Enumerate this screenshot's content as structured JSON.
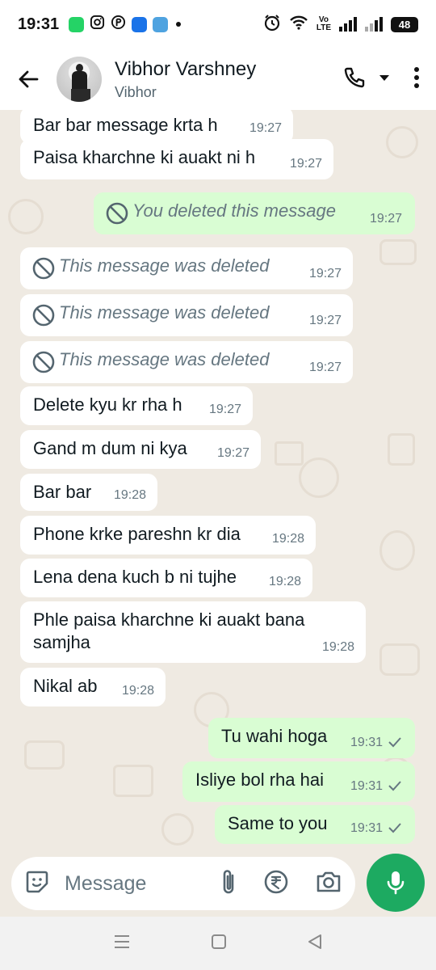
{
  "status_bar": {
    "time": "19:31",
    "volte_label_top": "Vo",
    "volte_label_bottom": "LTE",
    "battery": "48",
    "icons": [
      "whatsapp-business-icon",
      "instagram-icon",
      "phonepe-icon",
      "bluesky-icon",
      "weather-icon",
      "dot-icon",
      "alarm-icon",
      "wifi-icon",
      "volte-icon",
      "signal-icon",
      "battery-icon"
    ]
  },
  "header": {
    "contact_name": "Vibhor Varshney",
    "contact_subtitle": "Vibhor"
  },
  "messages": [
    {
      "dir": "in",
      "text": "Bar bar message krta h",
      "time": "19:27",
      "deleted": false
    },
    {
      "dir": "in",
      "text": "Paisa kharchne ki auakt ni h",
      "time": "19:27",
      "deleted": false
    },
    {
      "dir": "out",
      "text": "You deleted this message",
      "time": "19:27",
      "deleted": true
    },
    {
      "dir": "in",
      "text": "This message was deleted",
      "time": "19:27",
      "deleted": true
    },
    {
      "dir": "in",
      "text": "This message was deleted",
      "time": "19:27",
      "deleted": true
    },
    {
      "dir": "in",
      "text": "This message was deleted",
      "time": "19:27",
      "deleted": true
    },
    {
      "dir": "in",
      "text": "Delete kyu kr rha h",
      "time": "19:27",
      "deleted": false
    },
    {
      "dir": "in",
      "text": "Gand m dum ni kya",
      "time": "19:27",
      "deleted": false
    },
    {
      "dir": "in",
      "text": "Bar bar",
      "time": "19:28",
      "deleted": false
    },
    {
      "dir": "in",
      "text": "Phone krke pareshn kr dia",
      "time": "19:28",
      "deleted": false
    },
    {
      "dir": "in",
      "text": "Lena dena kuch b ni tujhe",
      "time": "19:28",
      "deleted": false
    },
    {
      "dir": "in",
      "text_line1": "Phle paisa kharchne ki auakt bana",
      "text_line2": "samjha",
      "time": "19:28",
      "deleted": false
    },
    {
      "dir": "in",
      "text": "Nikal ab",
      "time": "19:28",
      "deleted": false
    },
    {
      "dir": "out",
      "text": "Tu wahi hoga",
      "time": "19:31",
      "deleted": false,
      "status": "sent"
    },
    {
      "dir": "out",
      "text": "Isliye bol rha hai",
      "time": "19:31",
      "deleted": false,
      "status": "sent"
    },
    {
      "dir": "out",
      "text": "Same to you",
      "time": "19:31",
      "deleted": false,
      "status": "sent"
    }
  ],
  "composer": {
    "placeholder": "Message"
  },
  "colors": {
    "chat_background": "#efeae2",
    "incoming_bubble": "#ffffff",
    "outgoing_bubble": "#d9fdd3",
    "mic_button": "#1daa61",
    "timestamp": "#667781"
  }
}
